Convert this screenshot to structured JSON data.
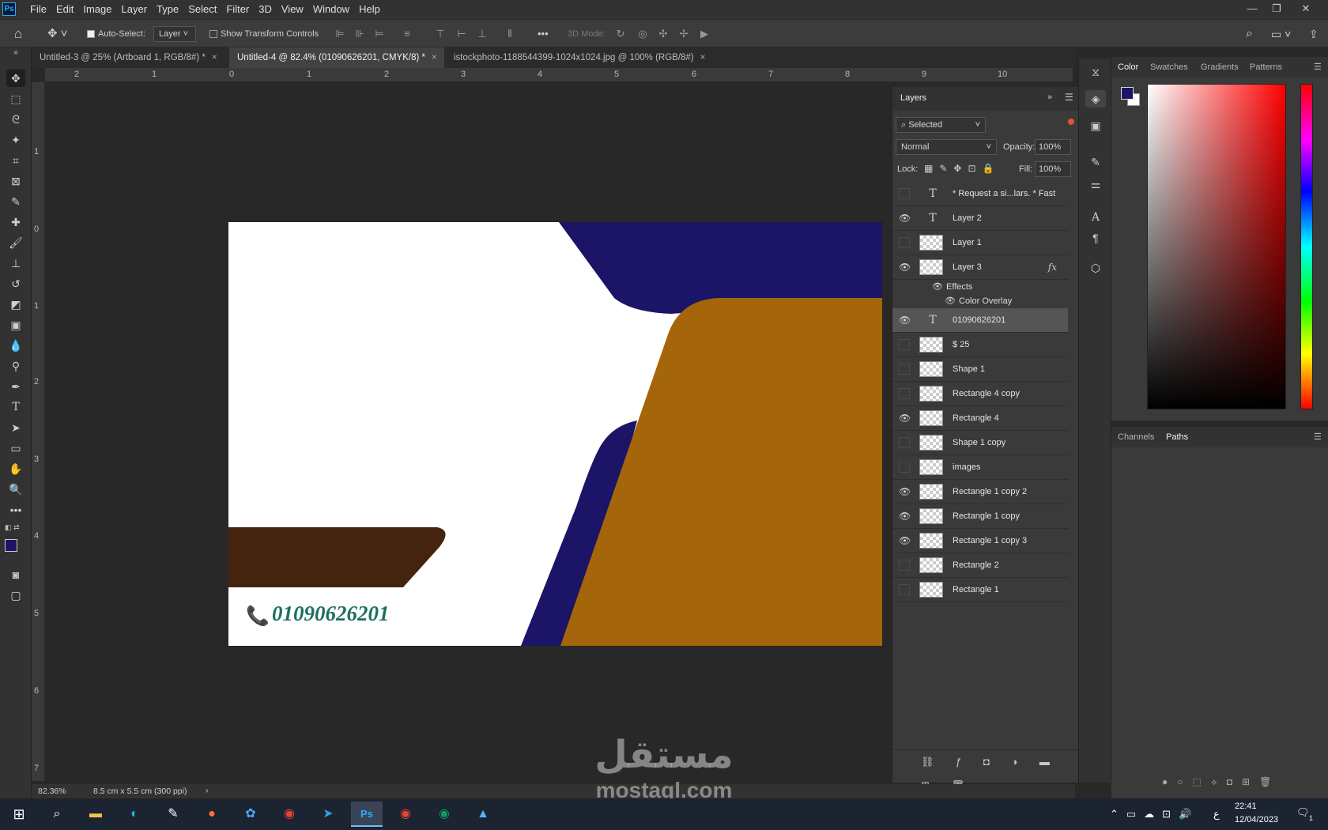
{
  "app": {
    "logo": "Ps"
  },
  "menu": [
    "File",
    "Edit",
    "Image",
    "Layer",
    "Type",
    "Select",
    "Filter",
    "3D",
    "View",
    "Window",
    "Help"
  ],
  "window_controls": {
    "minimize": "—",
    "restore": "❐",
    "close": "✕"
  },
  "options_bar": {
    "auto_select_label": "Auto-Select:",
    "auto_select_value": "Layer",
    "show_transform_label": "Show Transform Controls",
    "more": "•••",
    "mode_3d": "3D Mode:"
  },
  "tabs": [
    {
      "label": "Untitled-3 @ 25% (Artboard 1, RGB/8#) *",
      "close": "×"
    },
    {
      "label": "Untitled-4 @ 82.4% (01090626201, CMYK/8) *",
      "close": "×"
    },
    {
      "label": "istockphoto-1188544399-1024x1024.jpg @ 100% (RGB/8#)",
      "close": "×"
    }
  ],
  "ruler_top": [
    "2",
    "1",
    "0",
    "1",
    "2",
    "3",
    "4",
    "5",
    "6",
    "7",
    "8",
    "9",
    "10"
  ],
  "ruler_left": [
    "1",
    "0",
    "1",
    "2",
    "3",
    "4",
    "5",
    "6",
    "7"
  ],
  "canvas": {
    "phone_icon": "📞",
    "phone_text": "01090626201"
  },
  "colors": {
    "navy": "#1c1466",
    "orange": "#a5650a",
    "brown": "#45240f",
    "teal": "#1d6e63",
    "fg_swatch": "#1c1466"
  },
  "layers_panel": {
    "title": "Layers",
    "filter": "Selected",
    "blend": "Normal",
    "opacity_label": "Opacity:",
    "opacity": "100%",
    "lock_label": "Lock:",
    "fill_label": "Fill:",
    "fill": "100%",
    "effects_label": "Effects",
    "color_overlay_label": "Color Overlay",
    "fx": "fx",
    "layers": [
      {
        "name": "* Request a si...lars. * Fast",
        "type": "text",
        "visible": false
      },
      {
        "name": "Layer 2",
        "type": "text",
        "visible": true
      },
      {
        "name": "Layer 1",
        "type": "pixel",
        "visible": false
      },
      {
        "name": "Layer 3",
        "type": "pixel",
        "visible": true,
        "fx": true
      },
      {
        "name": "01090626201",
        "type": "text",
        "visible": true,
        "selected": true
      },
      {
        "name": "$ 25",
        "type": "pixel",
        "visible": false
      },
      {
        "name": "Shape 1",
        "type": "smart",
        "visible": false
      },
      {
        "name": "Rectangle 4 copy",
        "type": "smart",
        "visible": false
      },
      {
        "name": "Rectangle 4",
        "type": "smart",
        "visible": true
      },
      {
        "name": "Shape 1 copy",
        "type": "smart",
        "visible": false
      },
      {
        "name": "images",
        "type": "smart",
        "visible": false
      },
      {
        "name": "Rectangle 1 copy 2",
        "type": "smart",
        "visible": true
      },
      {
        "name": "Rectangle 1 copy",
        "type": "smart",
        "visible": true
      },
      {
        "name": "Rectangle 1 copy 3",
        "type": "smart",
        "visible": true
      },
      {
        "name": "Rectangle 2",
        "type": "smart",
        "visible": false
      },
      {
        "name": "Rectangle 1",
        "type": "smart",
        "visible": false
      }
    ]
  },
  "color_panel": {
    "tabs": [
      "Color",
      "Swatches",
      "Gradients",
      "Patterns"
    ]
  },
  "paths_panel": {
    "tabs": [
      "Channels",
      "Paths"
    ]
  },
  "status": {
    "zoom": "82.36%",
    "doc_info": "8.5 cm x 5.5 cm (300 ppi)",
    "arrow": "›"
  },
  "taskbar": {
    "time": "22:41",
    "date": "12/04/2023",
    "lang": "ع",
    "notif": "1"
  },
  "watermark": {
    "text_ar": "مستقل",
    "text_en": "mostaql.com"
  }
}
